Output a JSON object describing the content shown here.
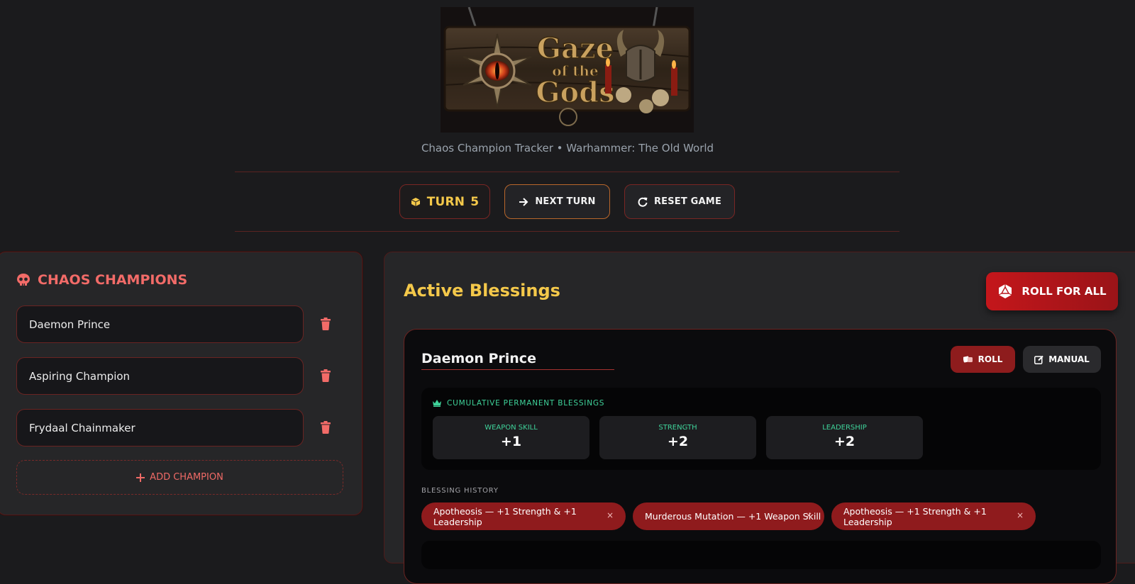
{
  "header": {
    "logo_text": "Gaze of the Gods",
    "subtitle": "Chaos Champion Tracker • Warhammer: The Old World"
  },
  "controls": {
    "turn_label": "TURN",
    "turn_value": "5",
    "next_turn_label": "NEXT TURN",
    "reset_label": "RESET GAME"
  },
  "champions_panel": {
    "title": "CHAOS CHAMPIONS",
    "champions": [
      {
        "name": "Daemon Prince"
      },
      {
        "name": "Aspiring Champion"
      },
      {
        "name": "Frydaal Chainmaker"
      }
    ],
    "add_label": "ADD CHAMPION"
  },
  "blessings_panel": {
    "title": "Active Blessings",
    "roll_all_label": "ROLL FOR ALL",
    "card": {
      "champion_name": "Daemon Prince",
      "roll_label": "ROLL",
      "manual_label": "MANUAL",
      "permanent_title": "CUMULATIVE PERMANENT BLESSINGS",
      "stats": [
        {
          "label": "WEAPON SKILL",
          "value": "+1"
        },
        {
          "label": "STRENGTH",
          "value": "+2"
        },
        {
          "label": "LEADERSHIP",
          "value": "+2"
        }
      ],
      "history_title": "BLESSING HISTORY",
      "history": [
        {
          "text": "Apotheosis — +1 Strength & +1 Leadership",
          "remove": "×"
        },
        {
          "text": "Murderous Mutation — +1 Weapon Skill",
          "remove": "×"
        },
        {
          "text": "Apotheosis — +1 Strength & +1 Leadership",
          "remove": "×"
        }
      ]
    }
  },
  "colors": {
    "background": "#1b1b1d",
    "accent_red": "#c4161b",
    "gold": "#f4c84a",
    "green": "#3fd39a",
    "pink_red": "#f26b68"
  }
}
